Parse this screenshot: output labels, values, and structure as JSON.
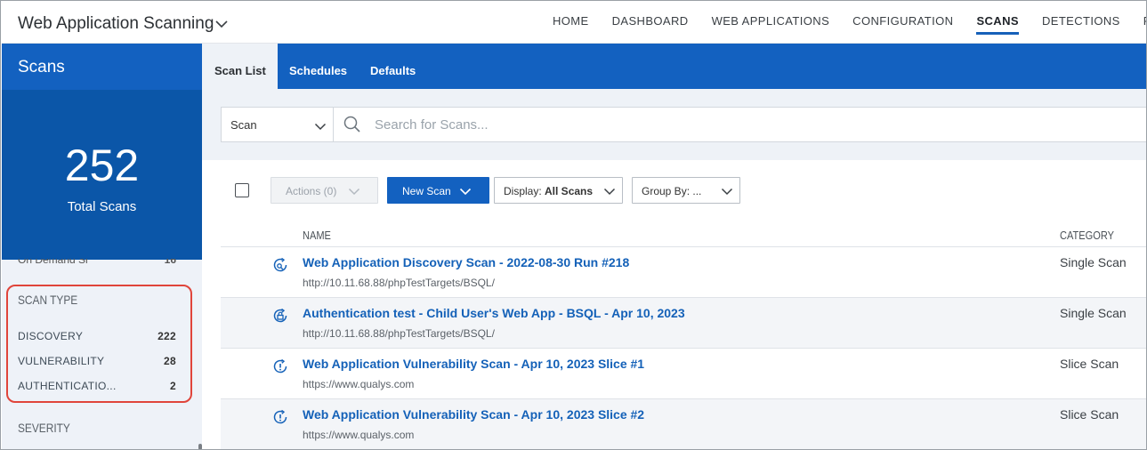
{
  "app": {
    "title": "Web Application Scanning"
  },
  "nav": {
    "items": [
      {
        "label": "HOME"
      },
      {
        "label": "DASHBOARD"
      },
      {
        "label": "WEB APPLICATIONS"
      },
      {
        "label": "CONFIGURATION"
      },
      {
        "label": "SCANS"
      },
      {
        "label": "DETECTIONS"
      },
      {
        "label": "REPO"
      }
    ],
    "active": "SCANS"
  },
  "sidebar": {
    "title": "Scans",
    "total_count": "252",
    "total_label": "Total Scans",
    "partial_row": {
      "label": "On Demand Sl",
      "count": "16"
    },
    "scan_type": {
      "title": "SCAN TYPE",
      "items": [
        {
          "label": "DISCOVERY",
          "count": "222"
        },
        {
          "label": "VULNERABILITY",
          "count": "28"
        },
        {
          "label": "AUTHENTICATIO...",
          "count": "2"
        }
      ]
    },
    "severity_title": "SEVERITY"
  },
  "tabs": [
    {
      "label": "Scan List",
      "active": true
    },
    {
      "label": "Schedules",
      "active": false
    },
    {
      "label": "Defaults",
      "active": false
    }
  ],
  "search": {
    "scope": "Scan",
    "placeholder": "Search for Scans..."
  },
  "toolbar": {
    "actions_label": "Actions (0)",
    "new_scan_label": "New Scan",
    "display_prefix": "Display: ",
    "display_value": "All Scans",
    "group_by_label": "Group By: ..."
  },
  "table": {
    "columns": [
      "NAME",
      "CATEGORY"
    ],
    "rows": [
      {
        "name": "Web Application Discovery Scan - 2022-08-30 Run #218",
        "url": "http://10.11.68.88/phpTestTargets/BSQL/",
        "category": "Single Scan",
        "icon": "discovery-scan-icon"
      },
      {
        "name": "Authentication test - Child User's Web App - BSQL - Apr 10, 2023",
        "url": "http://10.11.68.88/phpTestTargets/BSQL/",
        "category": "Single Scan",
        "icon": "authentication-scan-icon"
      },
      {
        "name": "Web Application Vulnerability Scan - Apr 10, 2023 Slice #1",
        "url": "https://www.qualys.com",
        "category": "Slice Scan",
        "icon": "vulnerability-scan-icon"
      },
      {
        "name": "Web Application Vulnerability Scan - Apr 10, 2023 Slice #2",
        "url": "https://www.qualys.com",
        "category": "Slice Scan",
        "icon": "vulnerability-scan-icon"
      }
    ]
  },
  "colors": {
    "brand_blue": "#1361c0",
    "total_panel_blue": "#0b56a8",
    "link_blue": "#1461b8",
    "highlight_red": "#e0453b"
  }
}
